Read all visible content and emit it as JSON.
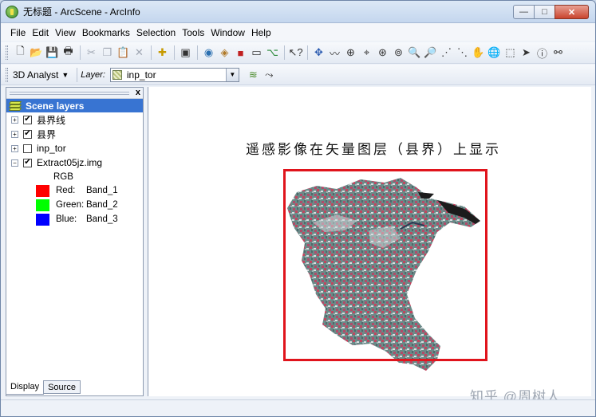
{
  "window": {
    "title": "无标题 - ArcScene - ArcInfo",
    "controls": {
      "minimize": "—",
      "maximize": "□",
      "close": "✕"
    }
  },
  "menu": [
    "File",
    "Edit",
    "View",
    "Bookmarks",
    "Selection",
    "Tools",
    "Window",
    "Help"
  ],
  "toolbar2": {
    "analyst_label": "3D Analyst",
    "layer_label": "Layer:",
    "layer_value": "inp_tor"
  },
  "toc": {
    "root": "Scene layers",
    "layers": [
      {
        "name": "县界线",
        "checked": true,
        "expanded": false
      },
      {
        "name": "县界",
        "checked": true,
        "expanded": false
      },
      {
        "name": "inp_tor",
        "checked": false,
        "expanded": false
      },
      {
        "name": "Extract05jz.img",
        "checked": true,
        "expanded": true
      }
    ],
    "composite": "RGB",
    "bands": [
      {
        "channel": "Red:",
        "band": "Band_1",
        "color": "#ff0000"
      },
      {
        "channel": "Green:",
        "band": "Band_2",
        "color": "#00ff00"
      },
      {
        "channel": "Blue:",
        "band": "Band_3",
        "color": "#0000ff"
      }
    ],
    "tabs": [
      "Display",
      "Source"
    ],
    "close": "x"
  },
  "scene": {
    "title": "遥感影像在矢量图层（县界）上显示",
    "frame_color": "#e0141c"
  },
  "watermark": "知乎 @周树人"
}
